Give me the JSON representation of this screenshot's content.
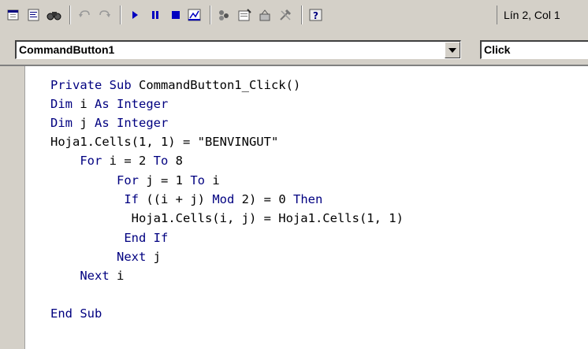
{
  "toolbar": {
    "buttons": [
      {
        "name": "view-object-icon"
      },
      {
        "name": "view-code-icon"
      },
      {
        "name": "find-icon"
      },
      {
        "name": "undo-icon"
      },
      {
        "name": "redo-icon"
      },
      {
        "name": "run-icon"
      },
      {
        "name": "break-icon"
      },
      {
        "name": "reset-icon"
      },
      {
        "name": "design-mode-icon"
      },
      {
        "name": "project-explorer-icon"
      },
      {
        "name": "properties-window-icon"
      },
      {
        "name": "object-browser-icon"
      },
      {
        "name": "toolbox-icon"
      },
      {
        "name": "help-icon"
      }
    ],
    "cursor_position": "Lín 2, Col 1"
  },
  "object_combo": {
    "value": "CommandButton1"
  },
  "procedure_combo": {
    "value": "Click"
  },
  "code": {
    "lines": [
      {
        "indent": "",
        "segments": [
          [
            "kw",
            "Private Sub "
          ],
          [
            "t",
            "CommandButton1_Click()"
          ]
        ]
      },
      {
        "indent": "",
        "segments": [
          [
            "kw",
            "Dim "
          ],
          [
            "t",
            "i "
          ],
          [
            "kw",
            "As Integer"
          ]
        ]
      },
      {
        "indent": "",
        "segments": [
          [
            "kw",
            "Dim "
          ],
          [
            "t",
            "j "
          ],
          [
            "kw",
            "As Integer"
          ]
        ]
      },
      {
        "indent": "",
        "segments": [
          [
            "t",
            "Hoja1.Cells(1, 1) = \"BENVINGUT\""
          ]
        ]
      },
      {
        "indent": "    ",
        "segments": [
          [
            "kw",
            "For "
          ],
          [
            "t",
            "i = 2 "
          ],
          [
            "kw",
            "To "
          ],
          [
            "t",
            "8"
          ]
        ]
      },
      {
        "indent": "         ",
        "segments": [
          [
            "kw",
            "For "
          ],
          [
            "t",
            "j = 1 "
          ],
          [
            "kw",
            "To "
          ],
          [
            "t",
            "i"
          ]
        ]
      },
      {
        "indent": "          ",
        "segments": [
          [
            "kw",
            "If "
          ],
          [
            "t",
            "((i + j) "
          ],
          [
            "kw",
            "Mod "
          ],
          [
            "t",
            "2) = 0 "
          ],
          [
            "kw",
            "Then"
          ]
        ]
      },
      {
        "indent": "           ",
        "segments": [
          [
            "t",
            "Hoja1.Cells(i, j) = Hoja1.Cells(1, 1)"
          ]
        ]
      },
      {
        "indent": "          ",
        "segments": [
          [
            "kw",
            "End If"
          ]
        ]
      },
      {
        "indent": "         ",
        "segments": [
          [
            "kw",
            "Next "
          ],
          [
            "t",
            "j"
          ]
        ]
      },
      {
        "indent": "    ",
        "segments": [
          [
            "kw",
            "Next "
          ],
          [
            "t",
            "i"
          ]
        ]
      },
      {
        "indent": "",
        "segments": []
      },
      {
        "indent": "",
        "segments": [
          [
            "kw",
            "End Sub"
          ]
        ]
      }
    ]
  }
}
